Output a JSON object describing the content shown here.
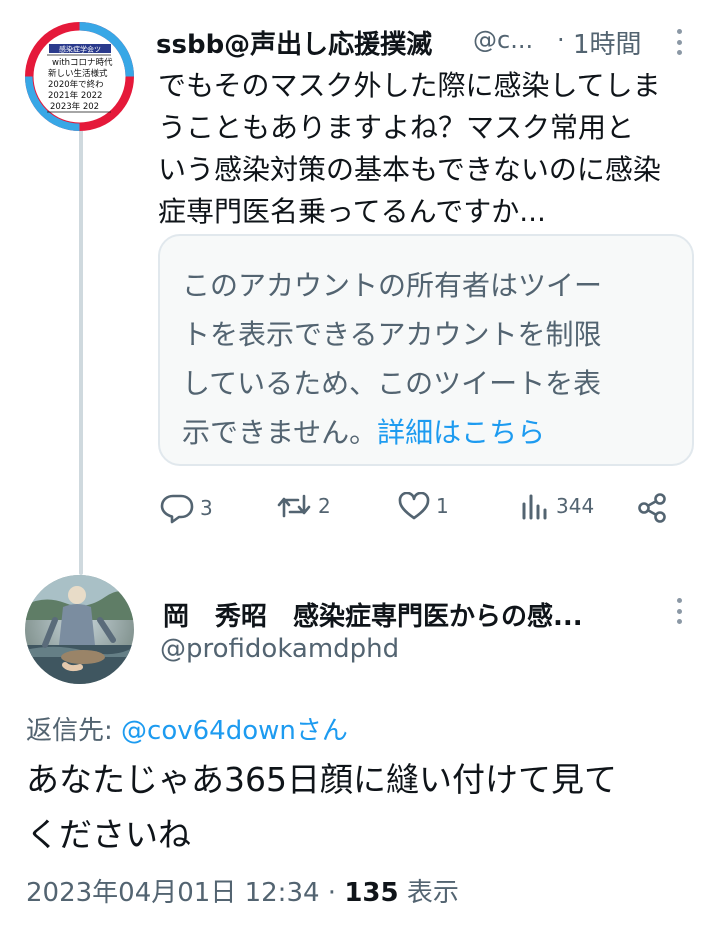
{
  "tweet1": {
    "author_name": "ssbb@声出し応援撲滅",
    "author_handle": "@c...",
    "separator": "·",
    "time": "1時間",
    "body_lines": [
      "でもそのマスク外した際に感染してしま",
      "うこともありますよね？マスク常用と",
      "いう感染対策の基本もできないのに感染",
      "症専門医名乗ってるんですか..."
    ],
    "avatar_text": {
      "top": "感染症学会ツ",
      "lines": [
        "withコロナ時代",
        "新しい生活様式",
        "2020年で終わ",
        "2021年 2022",
        "2023年 202"
      ]
    },
    "quote_notice": {
      "lines": [
        "このアカウントの所有者はツイー",
        "トを表示できるアカウントを制限",
        "しているため、このツイートを表"
      ],
      "last_line_prefix": "示できません。",
      "link": "詳細はこちら"
    },
    "actions": {
      "replies": "3",
      "retweets": "2",
      "likes": "1",
      "views": "344"
    }
  },
  "tweet2": {
    "author_name": "岡　秀昭　感染症専門医からの感...",
    "author_handle": "@profidokamdphd",
    "reply_to_label": "返信先: ",
    "reply_to_mention": "@cov64downさん",
    "body_lines": [
      "あなたじゃあ365日顔に縫い付けて見て",
      "くださいね"
    ],
    "timestamp": "2023年04月01日 12:34",
    "meta_separator": " · ",
    "views_count": "135",
    "views_label": " 表示"
  },
  "colors": {
    "text": "#0f1419",
    "secondary": "#536471",
    "link": "#1d9bf0",
    "thread_line": "#cfd9de",
    "notice_bg": "#f7f9f9"
  },
  "icons": [
    "reply-icon",
    "retweet-icon",
    "like-icon",
    "views-icon",
    "share-icon",
    "more-icon"
  ]
}
